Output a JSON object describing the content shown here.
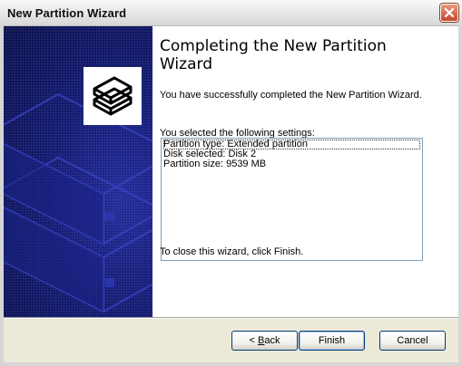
{
  "window": {
    "title": "New Partition Wizard"
  },
  "wizard": {
    "heading": "Completing the New Partition Wizard",
    "success_message": "You have successfully completed the New Partition Wizard.",
    "settings_label": "You selected the following settings:",
    "settings": [
      "Partition type: Extended partition",
      "Disk selected: Disk 2",
      "Partition size: 9539 MB"
    ],
    "close_hint": "To close this wizard, click Finish."
  },
  "buttons": {
    "back_accel": "B",
    "back_rest": "ack",
    "back_prefix": "< ",
    "finish": "Finish",
    "cancel": "Cancel"
  },
  "colors": {
    "panel_background": "#121a72",
    "button_border": "#003c74",
    "close_button": "#c6472a"
  },
  "icons": {
    "close": "close-icon",
    "wizard": "disk-stack-icon"
  }
}
